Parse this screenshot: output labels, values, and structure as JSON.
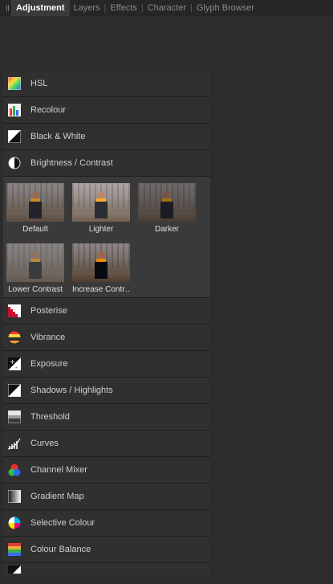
{
  "tabs": [
    {
      "label": "Adjustment",
      "active": true
    },
    {
      "label": "Layers",
      "active": false
    },
    {
      "label": "Effects",
      "active": false
    },
    {
      "label": "Character",
      "active": false
    },
    {
      "label": "Glyph Browser",
      "active": false
    }
  ],
  "tab_separator": "|",
  "adjustments_top": [
    {
      "label": "HSL",
      "icon": "hsl-icon"
    },
    {
      "label": "Recolour",
      "icon": "recolour-icon"
    },
    {
      "label": "Black & White",
      "icon": "black-white-icon"
    },
    {
      "label": "Brightness / Contrast",
      "icon": "brightness-contrast-icon"
    }
  ],
  "presets": [
    {
      "label": "Default"
    },
    {
      "label": "Lighter"
    },
    {
      "label": "Darker"
    },
    {
      "label": "Lower Contrast"
    },
    {
      "label": "Increase Contr…"
    }
  ],
  "adjustments_bottom": [
    {
      "label": "Posterise",
      "icon": "posterise-icon"
    },
    {
      "label": "Vibrance",
      "icon": "vibrance-icon"
    },
    {
      "label": "Exposure",
      "icon": "exposure-icon"
    },
    {
      "label": "Shadows / Highlights",
      "icon": "shadows-highlights-icon"
    },
    {
      "label": "Threshold",
      "icon": "threshold-icon"
    },
    {
      "label": "Curves",
      "icon": "curves-icon"
    },
    {
      "label": "Channel Mixer",
      "icon": "channel-mixer-icon"
    },
    {
      "label": "Gradient Map",
      "icon": "gradient-map-icon"
    },
    {
      "label": "Selective Colour",
      "icon": "selective-colour-icon"
    },
    {
      "label": "Colour Balance",
      "icon": "colour-balance-icon"
    }
  ]
}
